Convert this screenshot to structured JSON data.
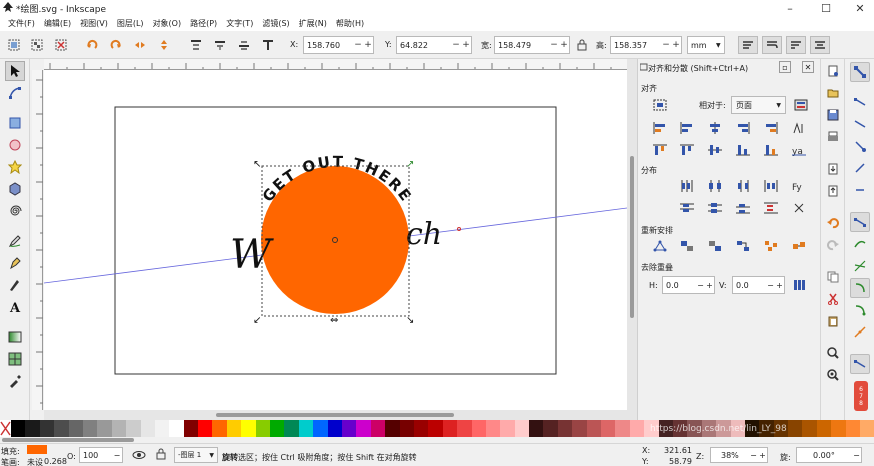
{
  "window": {
    "title": "*绘图.svg - Inkscape",
    "minimize": "–",
    "maximize": "☐",
    "close": "✕"
  },
  "menu": [
    "文件(F)",
    "编辑(E)",
    "视图(V)",
    "图层(L)",
    "对象(O)",
    "路径(P)",
    "文字(T)",
    "滤镜(S)",
    "扩展(N)",
    "帮助(H)"
  ],
  "toolbar": {
    "x_label": "X:",
    "x_value": "158.760",
    "y_label": "Y:",
    "y_value": "64.822",
    "w_label": "宽:",
    "w_value": "158.479",
    "h_label": "高:",
    "h_value": "158.357",
    "unit": "mm",
    "minus": "−",
    "plus": "+"
  },
  "canvas": {
    "arc_text": "GET OUT THERE",
    "script_left": "W",
    "script_right": "ch",
    "circle_color": "#ff6600",
    "guide_color": "#6666dd"
  },
  "dock": {
    "title": "对齐和分散 (Shift+Ctrl+A)",
    "section_align": "对齐",
    "relative_label": "相对于:",
    "relative_value": "页面",
    "section_distribute": "分布",
    "section_rearrange": "重新安排",
    "section_overlap": "去除重叠",
    "h_label": "H:",
    "h_value": "0.0",
    "v_label": "V:",
    "v_value": "0.0"
  },
  "palette": {
    "colors": [
      "#000000",
      "#1a1a1a",
      "#333333",
      "#4d4d4d",
      "#666666",
      "#808080",
      "#999999",
      "#b3b3b3",
      "#cccccc",
      "#e6e6e6",
      "#f2f2f2",
      "#ffffff",
      "#800000",
      "#ff0000",
      "#ff6600",
      "#ffcc00",
      "#ffff00",
      "#88cc00",
      "#00aa00",
      "#008855",
      "#00cccc",
      "#0066ff",
      "#0000cc",
      "#6600cc",
      "#cc00cc",
      "#cc0066",
      "#550000",
      "#770000",
      "#990000",
      "#bb0000",
      "#dd2222",
      "#ee4444",
      "#ff6666",
      "#ff8888",
      "#ffaaaa",
      "#ffcccc",
      "#331111",
      "#552222",
      "#773333",
      "#994444",
      "#bb5555",
      "#dd6666",
      "#ee8888",
      "#ffaaaa",
      "#ffcccc",
      "#442222",
      "#663333",
      "#885555",
      "#aa7777",
      "#cc9999",
      "#eebbbb",
      "#221100",
      "#442200",
      "#663300",
      "#884400",
      "#aa5500",
      "#cc6600",
      "#ee7711",
      "#ff8833",
      "#ffaa66"
    ]
  },
  "status": {
    "fill_label": "填充:",
    "stroke_label": "笔画:",
    "stroke_value": "未设",
    "stroke_width": "0.268",
    "opacity_label": "O:",
    "opacity_value": "100",
    "layer_value": "-图层 1",
    "message_prefix": "旋转",
    "message_body": "选区；按住 Ctrl 吸附角度；按住 Shift 在对角旋转",
    "x_label": "X:",
    "x_value": "321.61",
    "y_label": "Y:",
    "y_value": "58.79",
    "z_label": "Z:",
    "zoom_value": "38%",
    "r_label": "旋:",
    "rotation_value": "0.00°",
    "watermark": "https://blog.csdn.net/lin_LY_98"
  },
  "colors": {
    "fill": "#ff6600",
    "accent_green": "#2d8a2d",
    "accent_blue": "#3355aa",
    "accent_orange": "#e07b20"
  }
}
